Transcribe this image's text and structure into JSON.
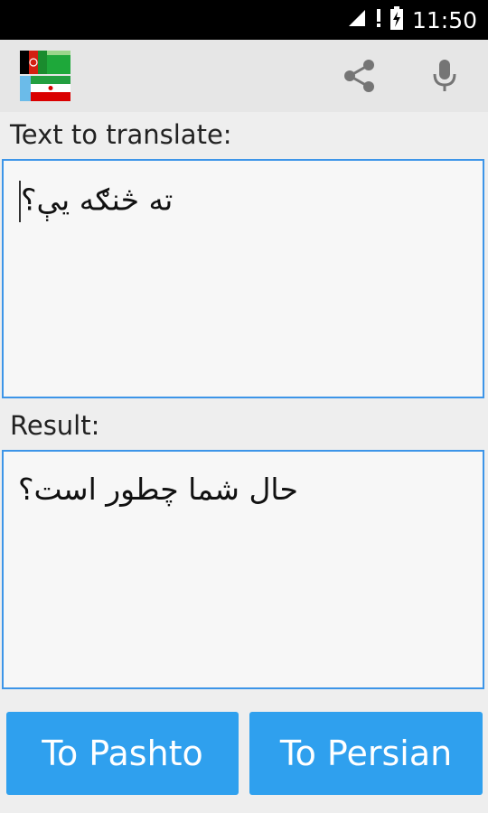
{
  "status_bar": {
    "time": "11:50",
    "icons": [
      "signal-icon",
      "alert-icon",
      "battery-charging-icon"
    ]
  },
  "app_bar": {
    "logo": "afghanistan-iran-flags-logo",
    "actions": [
      {
        "name": "share",
        "icon": "share-icon"
      },
      {
        "name": "voice-input",
        "icon": "microphone-icon"
      }
    ]
  },
  "input_section": {
    "label": "Text to translate:",
    "value": "ته څنګه یې؟"
  },
  "result_section": {
    "label": "Result:",
    "value": "حال شما چطور است؟"
  },
  "buttons": {
    "to_pashto": "To Pashto",
    "to_persian": "To Persian"
  },
  "colors": {
    "accent": "#3d95e8",
    "button": "#2fa0ee",
    "appbar": "#e6e6e6"
  }
}
